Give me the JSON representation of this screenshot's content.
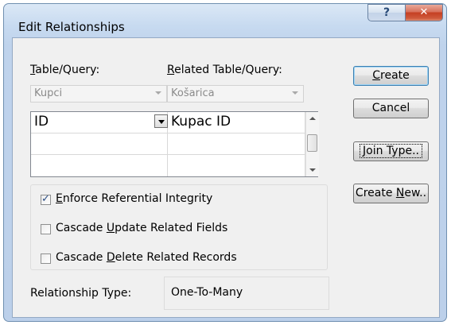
{
  "window": {
    "title": "Edit Relationships",
    "help_glyph": "?",
    "close_glyph": "✕"
  },
  "labels": {
    "table_query": [
      "",
      "T",
      "able/Query:"
    ],
    "related_table_query": [
      "",
      "R",
      "elated Table/Query:"
    ]
  },
  "combos": {
    "table": "Kupci",
    "related": "Košarica"
  },
  "grid": {
    "rows": [
      {
        "left": "ID",
        "right": "Kupac ID"
      },
      {
        "left": "",
        "right": ""
      },
      {
        "left": "",
        "right": ""
      }
    ]
  },
  "options": {
    "enforce": {
      "pre": "",
      "key": "E",
      "post": "nforce Referential Integrity",
      "checked": true
    },
    "cascade_update": {
      "pre": "Cascade ",
      "key": "U",
      "post": "pdate Related Fields",
      "checked": false
    },
    "cascade_delete": {
      "pre": "Cascade ",
      "key": "D",
      "post": "elete Related Records",
      "checked": false
    }
  },
  "relationship": {
    "label": "Relationship Type:",
    "value": "One-To-Many"
  },
  "buttons": {
    "create": {
      "pre": "",
      "key": "C",
      "post": "reate"
    },
    "cancel": "Cancel",
    "join_type": {
      "pre": "",
      "key": "J",
      "post": "oin Type.."
    },
    "create_new": {
      "pre": "Create ",
      "key": "N",
      "post": "ew.."
    }
  }
}
